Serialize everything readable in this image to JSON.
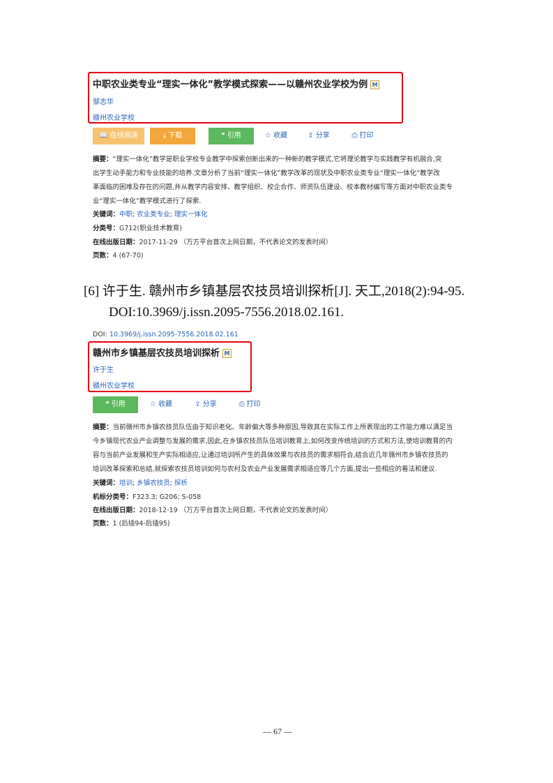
{
  "card1": {
    "title": "中职农业类专业“理实一体化”教学模式探索——以赣州农业学校为例",
    "badge": "M",
    "author": "邹志华",
    "institution": "赣州农业学校",
    "buttons": {
      "read": "在线阅读",
      "download": "下载",
      "cite": "引用",
      "collect": "收藏",
      "share": "分享",
      "print": "打印"
    },
    "abstract_label": "摘要：",
    "abstract_lines": [
      "“理实一体化”教学是职业学校专业教学中探索创新出来的一种新的教学模式,它将理论教学与实践教学有机融合,突",
      "出学生动手能力和专业技能的培养.文章分析了当前“理实一体化”教学改革的现状及中职农业类专业“理实一体化”教学改",
      "革面临的困难及存在的问题,并从教学内容安排、教学组织、校企合作、师资队伍建设、校本教材编写等方面对中职农业类专",
      "业“理实一体化”教学模式进行了探索."
    ],
    "keywords_label": "关键词：",
    "keywords": [
      "中职",
      "农业类专业",
      "理实一体化"
    ],
    "class_label": "分类号：",
    "class_value": "G712(职业技术教育)",
    "date_label": "在线出版日期：",
    "date_value": "2017-11-29",
    "date_note": "（万方平台首次上网日期，不代表论文的发表时间）",
    "pages_label": "页数：",
    "pages_value": "4 (67-70)"
  },
  "reference": {
    "line1": "[6]  许于生.  赣州市乡镇基层农技员培训探析[J].  天工,2018(2):94-95.",
    "line2": "DOI:10.3969/j.issn.2095-7556.2018.02.161."
  },
  "card2": {
    "doi_label": "DOI:",
    "doi_value": "10.3969/j.issn.2095-7556.2018.02.161",
    "title": "赣州市乡镇基层农技员培训探析",
    "badge": "M",
    "author": "许于生",
    "institution": "赣州农业学校",
    "buttons": {
      "cite": "引用",
      "collect": "收藏",
      "share": "分享",
      "print": "打印"
    },
    "abstract_label": "摘要：",
    "abstract_lines": [
      "当前赣州市乡镇农技员队伍由于知识老化、年龄偏大等多种原因,导致其在实际工作上所表现出的工作能力难以满足当",
      "今乡镇现代农业产业调整与发展的需求,因此,在乡镇农技员队伍培训教育上,如何改变传统培训的方式和方法,使培训教育的内",
      "容与当前产业发展和生产实际相适应,让通过培训所产生的具体效果与农技员的需求相符合,结合近几年赣州市乡镇农技员的",
      "培训改革探索和总结,就探索农技员培训如何与农村及农业产业发展需求相适应等几个方面,提出一些相应的看法和建议."
    ],
    "keywords_label": "关键词：",
    "keywords": [
      "培训",
      "乡镇农技员",
      "探析"
    ],
    "class_label": "机标分类号：",
    "class_value": "F323.3;  G206;  S-058",
    "date_label": "在线出版日期：",
    "date_value": "2018-12-19",
    "date_note": "（万方平台首次上网日期，不代表论文的发表时间）",
    "pages_label": "页数：",
    "pages_value": "1 (后插94-后插95)"
  },
  "page_number": "— 67 —",
  "colors": {
    "highlight": "#e60012",
    "link": "#2763b8",
    "read_button": "#f6c46f",
    "download_button": "#f2a73b",
    "cite_button": "#5cb85c"
  }
}
